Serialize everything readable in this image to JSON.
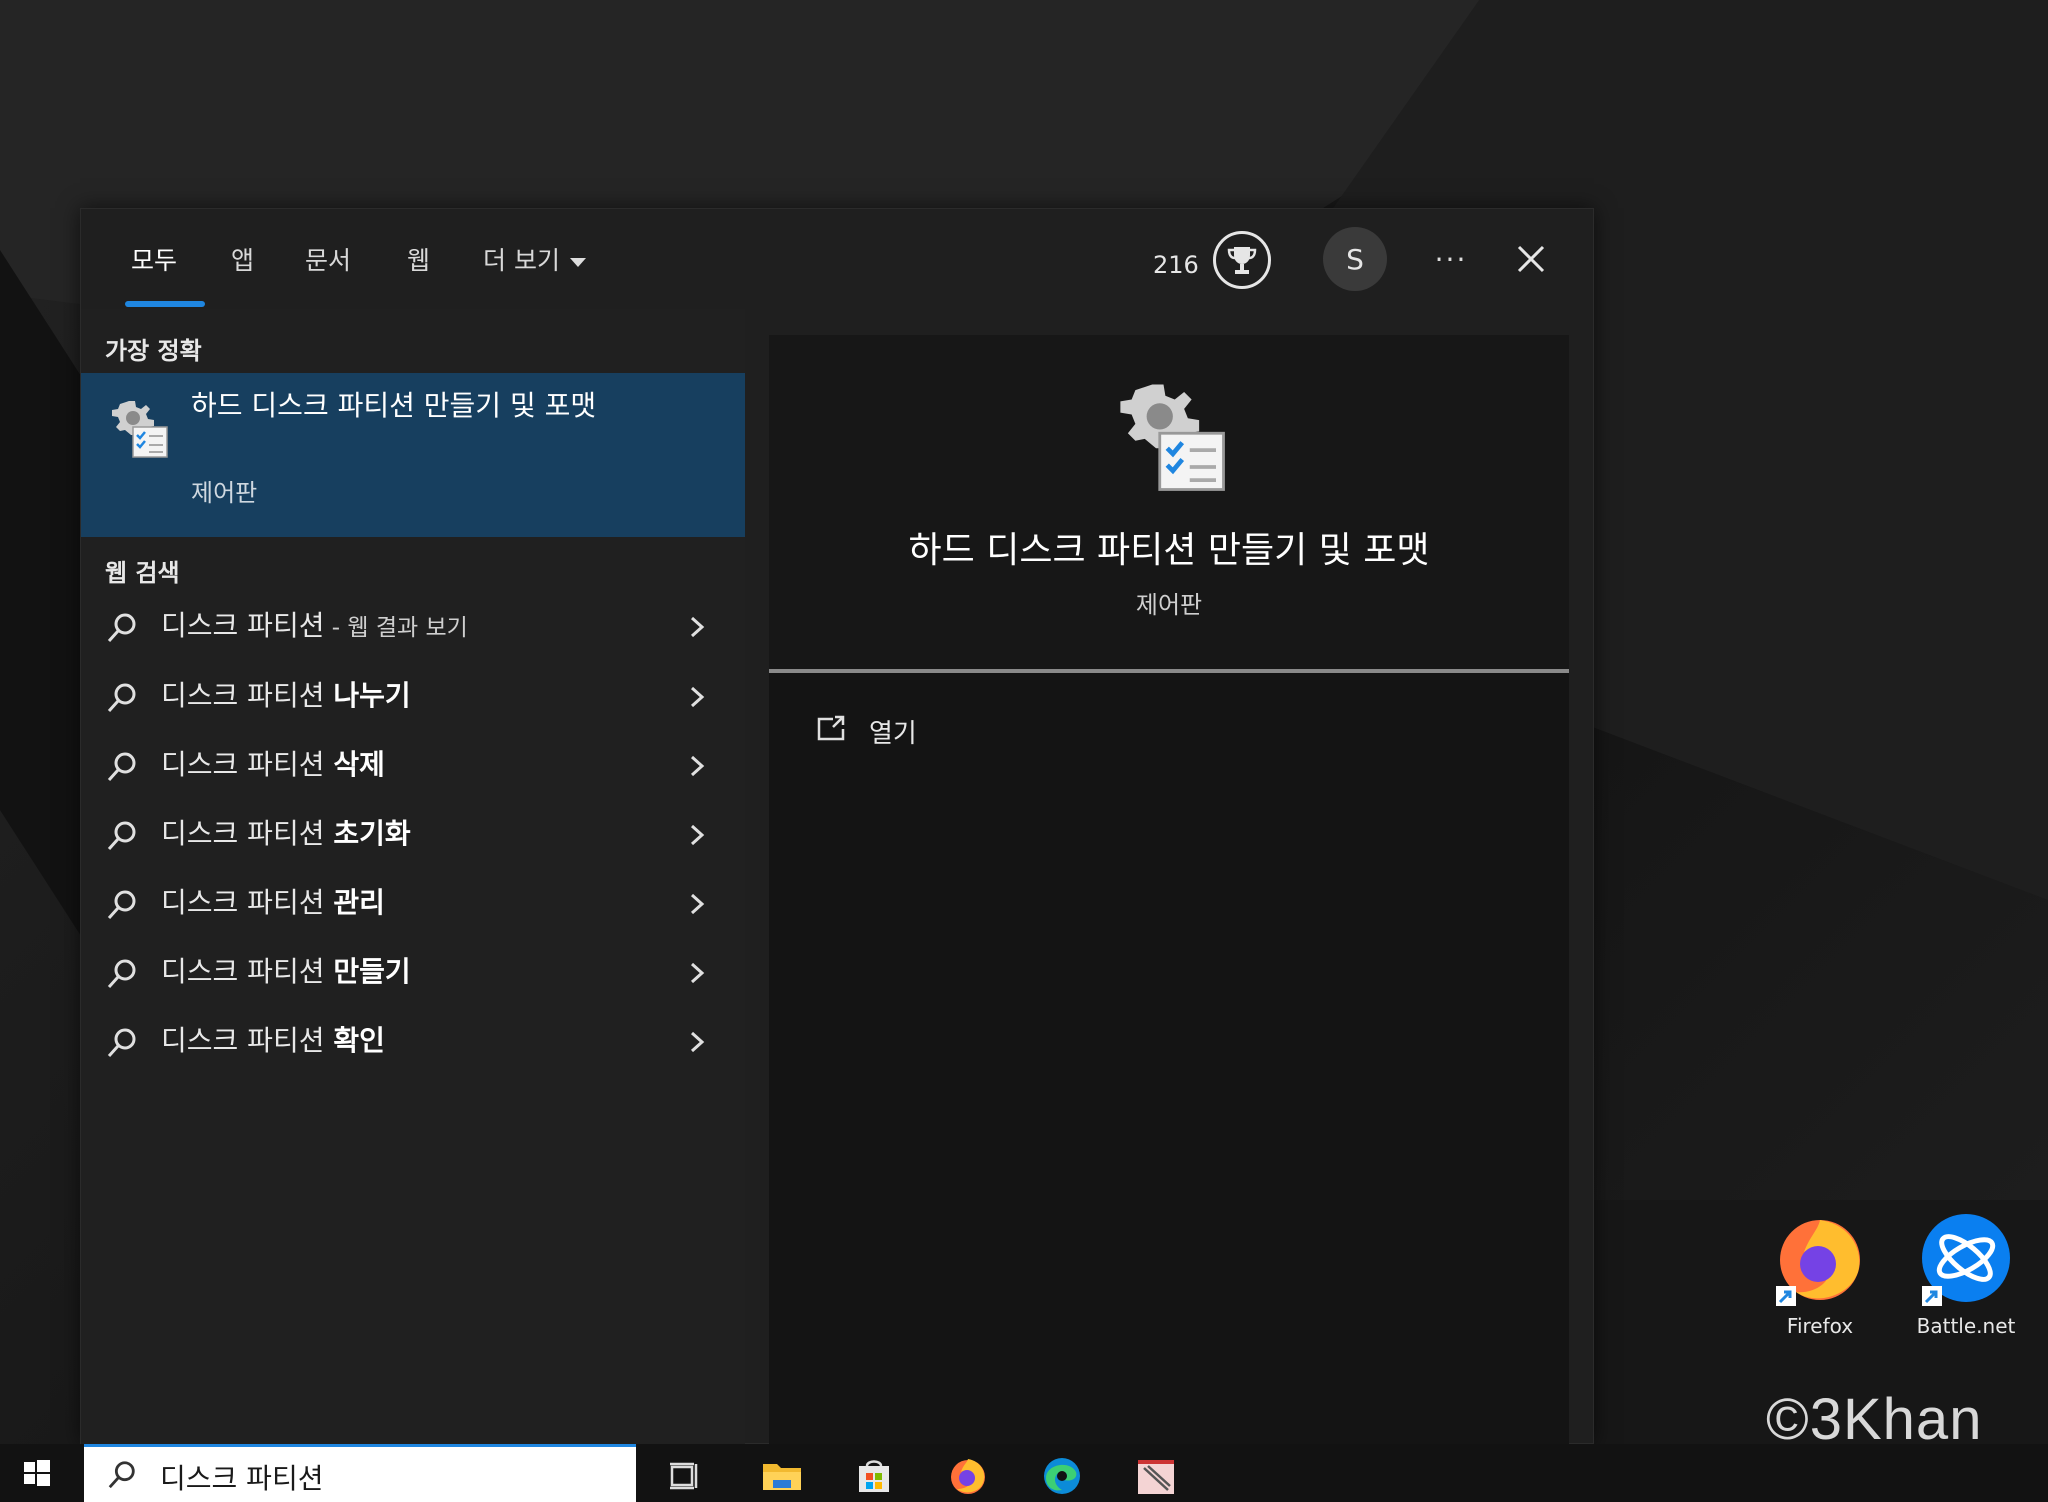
{
  "tabs": [
    {
      "label": "모두"
    },
    {
      "label": "앱"
    },
    {
      "label": "문서"
    },
    {
      "label": "웹"
    },
    {
      "label": "더 보기"
    }
  ],
  "header": {
    "points": "216",
    "avatar_initial": "S",
    "more_label": "···"
  },
  "best_match": {
    "section_label": "가장 정확",
    "title": "하드 디스크 파티션 만들기 및 포맷",
    "subtitle": "제어판"
  },
  "web_search": {
    "section_label": "웹 검색",
    "items": [
      {
        "prefix": "디스크 파티션",
        "suffix": " - 웹 결과 보기",
        "bold": ""
      },
      {
        "prefix": "디스크 파티션 ",
        "suffix": "",
        "bold": "나누기"
      },
      {
        "prefix": "디스크 파티션 ",
        "suffix": "",
        "bold": "삭제"
      },
      {
        "prefix": "디스크 파티션 ",
        "suffix": "",
        "bold": "초기화"
      },
      {
        "prefix": "디스크 파티션 ",
        "suffix": "",
        "bold": "관리"
      },
      {
        "prefix": "디스크 파티션 ",
        "suffix": "",
        "bold": "만들기"
      },
      {
        "prefix": "디스크 파티션 ",
        "suffix": "",
        "bold": "확인"
      }
    ]
  },
  "preview": {
    "title": "하드 디스크 파티션 만들기 및 포맷",
    "subtitle": "제어판",
    "actions": [
      {
        "label": "열기"
      }
    ]
  },
  "desktop_icons": [
    {
      "label": "Firefox"
    },
    {
      "label": "Battle.net"
    }
  ],
  "watermark": "©3Khan",
  "taskbar": {
    "search_value": "디스크 파티션"
  },
  "colors": {
    "accent": "#1f86e0",
    "selected_bg": "#173f5f"
  }
}
